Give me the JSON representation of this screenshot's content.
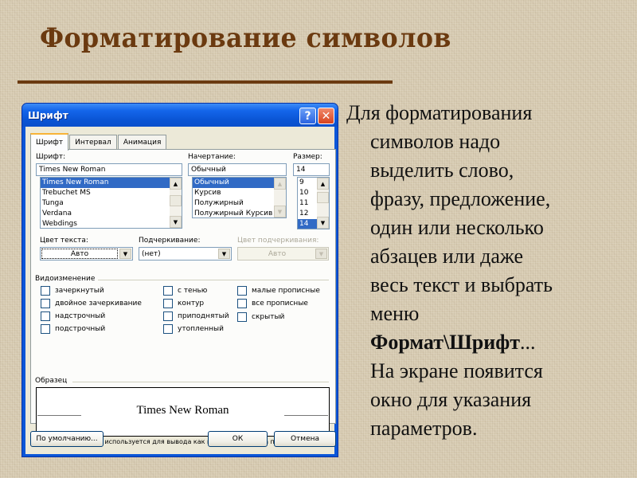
{
  "slide": {
    "title": "Форматирование символов",
    "colors": {
      "title": "#6b3a10",
      "background": "#d8ccb3"
    },
    "body_lines": [
      "Для форматирования",
      "символов надо",
      "выделить слово,",
      "фразу, предложение,",
      "один или несколько",
      "абзацев или даже",
      "весь текст и выбрать",
      "меню"
    ],
    "menu_path_bold": "Формат\\Шрифт",
    "menu_path_suffix": "...",
    "body_lines_after": [
      "На экране появится",
      "окно для указания",
      "параметров."
    ]
  },
  "dialog": {
    "title": "Шрифт",
    "help_icon": "?",
    "close_icon": "✕",
    "tabs": [
      {
        "label": "Шрифт",
        "active": true
      },
      {
        "label": "Интервал",
        "active": false
      },
      {
        "label": "Анимация",
        "active": false
      }
    ],
    "font": {
      "label": "Шрифт:",
      "value": "Times New Roman",
      "items": [
        "Times New Roman",
        "Trebuchet MS",
        "Tunga",
        "Verdana",
        "Webdings"
      ],
      "selected": "Times New Roman"
    },
    "style": {
      "label": "Начертание:",
      "value": "Обычный",
      "items": [
        "Обычный",
        "Курсив",
        "Полужирный",
        "Полужирный Курсив"
      ],
      "selected": "Обычный"
    },
    "size": {
      "label": "Размер:",
      "value": "14",
      "items": [
        "9",
        "10",
        "11",
        "12",
        "14"
      ],
      "selected": "14"
    },
    "text_color": {
      "label": "Цвет текста:",
      "value": "Авто"
    },
    "underline": {
      "label": "Подчеркивание:",
      "value": "(нет)"
    },
    "underline_color": {
      "label": "Цвет подчеркивания:",
      "value": "Авто",
      "disabled": true
    },
    "effects": {
      "title": "Видоизменение",
      "items": [
        {
          "label": "зачеркнутый",
          "checked": false
        },
        {
          "label": "двойное зачеркивание",
          "checked": false
        },
        {
          "label": "надстрочный",
          "checked": false
        },
        {
          "label": "подстрочный",
          "checked": false
        },
        {
          "label": "с тенью",
          "checked": false
        },
        {
          "label": "контур",
          "checked": false
        },
        {
          "label": "приподнятый",
          "checked": false
        },
        {
          "label": "утопленный",
          "checked": false
        },
        {
          "label": "малые прописные",
          "checked": false
        },
        {
          "label": "все прописные",
          "checked": false
        },
        {
          "label": "скрытый",
          "checked": false
        }
      ]
    },
    "preview": {
      "title": "Образец",
      "sample": "Times New Roman",
      "note": "Шрифт TrueType. Он используется для вывода как на экран, так и на принтер."
    },
    "buttons": {
      "default": "По умолчанию...",
      "ok": "ОК",
      "cancel": "Отмена"
    }
  }
}
